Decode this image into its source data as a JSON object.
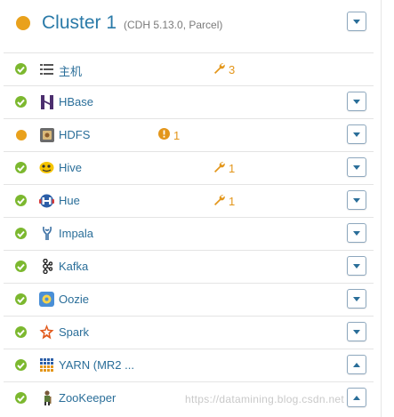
{
  "colors": {
    "ok": "#7cb82f",
    "warning": "#e9a11c",
    "link": "#2a6e99",
    "badge": "#e3961b"
  },
  "cluster": {
    "name": "Cluster 1",
    "meta": "(CDH 5.13.0, Parcel)",
    "status": "warning",
    "menu_icon": "chevron-down-icon"
  },
  "services": [
    {
      "name": "主机",
      "icon": "hosts-list-icon",
      "status": "ok",
      "config_issues": "3",
      "menu": "none"
    },
    {
      "name": "HBase",
      "icon": "hbase-icon",
      "status": "ok",
      "menu": "down"
    },
    {
      "name": "HDFS",
      "icon": "hdfs-icon",
      "status": "warning",
      "health_issues": "1",
      "menu": "down"
    },
    {
      "name": "Hive",
      "icon": "hive-icon",
      "status": "ok",
      "config_issues": "1",
      "menu": "down"
    },
    {
      "name": "Hue",
      "icon": "hue-icon",
      "status": "ok",
      "config_issues": "1",
      "menu": "down"
    },
    {
      "name": "Impala",
      "icon": "impala-icon",
      "status": "ok",
      "menu": "down"
    },
    {
      "name": "Kafka",
      "icon": "kafka-icon",
      "status": "ok",
      "menu": "down"
    },
    {
      "name": "Oozie",
      "icon": "oozie-icon",
      "status": "ok",
      "menu": "down"
    },
    {
      "name": "Spark",
      "icon": "spark-icon",
      "status": "ok",
      "menu": "down"
    },
    {
      "name": "YARN (MR2 ...",
      "icon": "yarn-icon",
      "status": "ok",
      "menu": "up"
    },
    {
      "name": "ZooKeeper",
      "icon": "zookeeper-icon",
      "status": "ok",
      "menu": "up"
    }
  ],
  "watermark": "https://datamining.blog.csdn.net"
}
